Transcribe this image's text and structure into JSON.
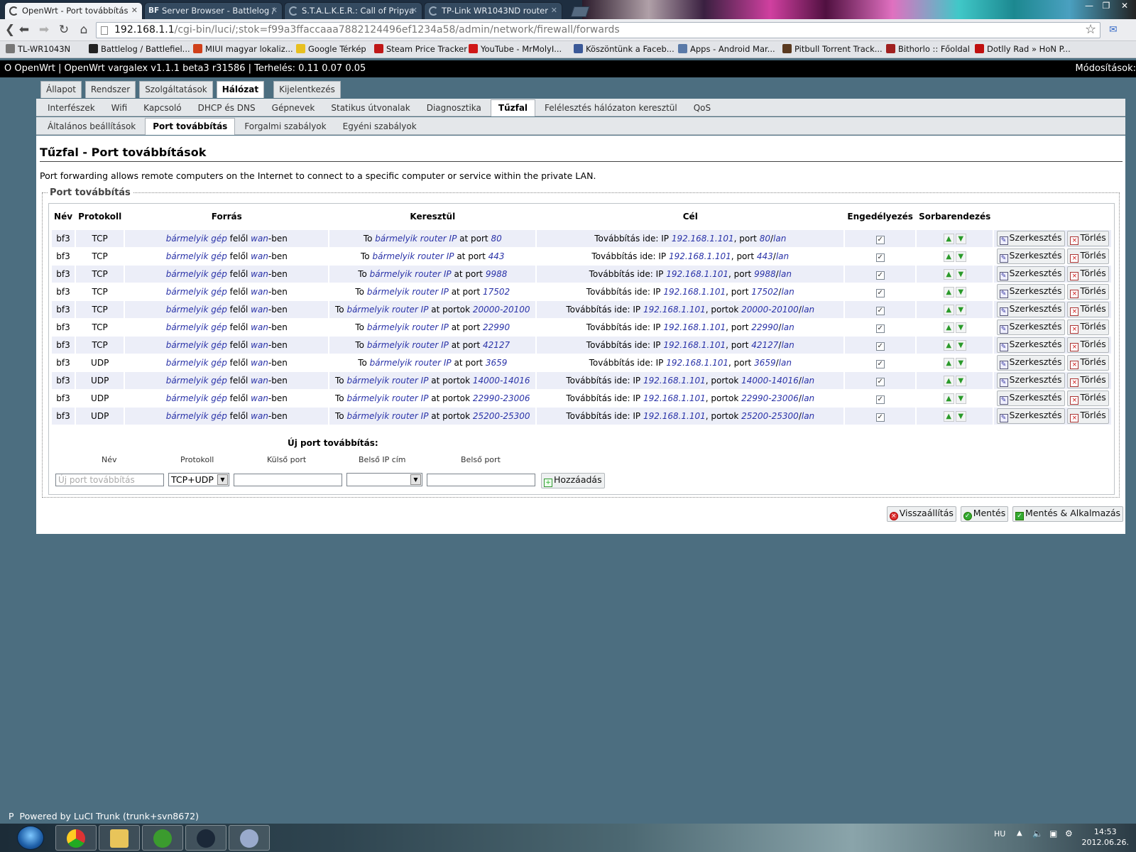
{
  "browser": {
    "tabs": [
      {
        "title": "OpenWrt - Port továbbítás",
        "active": true
      },
      {
        "title": "Server Browser - Battlelog /",
        "active": false
      },
      {
        "title": "S.T.A.L.K.E.R.: Call of Pripya",
        "active": false
      },
      {
        "title": "TP-Link WR1043ND router",
        "active": false
      }
    ],
    "url_host": "192.168.1.1",
    "url_path": "/cgi-bin/luci/;stok=f99a3ffaccaaa7882124496ef1234a58/admin/network/firewall/forwards",
    "bookmarks": [
      {
        "label": "TL-WR1043N",
        "icon": "globe-icon",
        "color": "#777777"
      },
      {
        "label": "Battlelog / Battlefiel...",
        "icon": "battlelog-icon",
        "color": "#222222"
      },
      {
        "label": "MIUI magyar lokaliz...",
        "icon": "miui-icon",
        "color": "#d0401a"
      },
      {
        "label": "Google Térkép",
        "icon": "maps-icon",
        "color": "#e8c020"
      },
      {
        "label": "Steam Price Tracker",
        "icon": "steam-icon",
        "color": "#c01818"
      },
      {
        "label": "YouTube - MrMolyI...",
        "icon": "youtube-icon",
        "color": "#d01818"
      },
      {
        "label": "Köszöntünk a Faceb...",
        "icon": "facebook-icon",
        "color": "#3b5998"
      },
      {
        "label": "Apps - Android Mar...",
        "icon": "play-icon",
        "color": "#5a7aa8"
      },
      {
        "label": "Pitbull Torrent Track...",
        "icon": "pitbull-icon",
        "color": "#5a3a20"
      },
      {
        "label": "Bithorlo :: Főoldal",
        "icon": "bithorlo-icon",
        "color": "#a02020"
      },
      {
        "label": "Dotlly Rad » HoN P...",
        "icon": "hon-icon",
        "color": "#c01010"
      }
    ]
  },
  "header": {
    "status": "OpenWrt | OpenWrt vargalex v1.1.1 beta3 r31586 | Terhelés: 0.11 0.07 0.05",
    "prefix": "O",
    "changes": "Módosítások:"
  },
  "menu_top": [
    "Állapot",
    "Rendszer",
    "Szolgáltatások",
    "Hálózat",
    "Kijelentkezés"
  ],
  "menu_top_selected": "Hálózat",
  "menu_network": [
    "Interfészek",
    "Wifi",
    "Kapcsoló",
    "DHCP és DNS",
    "Gépnevek",
    "Statikus útvonalak",
    "Diagnosztika",
    "Tűzfal",
    "Felélesztés hálózaton keresztül",
    "QoS"
  ],
  "menu_network_selected": "Tűzfal",
  "menu_firewall": [
    "Általános beállítások",
    "Port továbbítás",
    "Forgalmi szabályok",
    "Egyéni szabályok"
  ],
  "menu_firewall_selected": "Port továbbítás",
  "page": {
    "title": "Tűzfal - Port továbbítások",
    "description": "Port forwarding allows remote computers on the Internet to connect to a specific computer or service within the private LAN.",
    "legend": "Port továbbítás"
  },
  "table": {
    "headers": [
      "Név",
      "Protokoll",
      "Forrás",
      "Keresztül",
      "Cél",
      "Engedélyezés",
      "Sorbarendezés"
    ],
    "rows": [
      {
        "name": "bf3",
        "proto": "TCP",
        "via_prefix": "at port",
        "via_port": "80",
        "dest_prefix": "port",
        "dest_port": "80",
        "enabled": true
      },
      {
        "name": "bf3",
        "proto": "TCP",
        "via_prefix": "at port",
        "via_port": "443",
        "dest_prefix": "port",
        "dest_port": "443",
        "enabled": true
      },
      {
        "name": "bf3",
        "proto": "TCP",
        "via_prefix": "at port",
        "via_port": "9988",
        "dest_prefix": "port",
        "dest_port": "9988",
        "enabled": true
      },
      {
        "name": "bf3",
        "proto": "TCP",
        "via_prefix": "at port",
        "via_port": "17502",
        "dest_prefix": "port",
        "dest_port": "17502",
        "enabled": true
      },
      {
        "name": "bf3",
        "proto": "TCP",
        "via_prefix": "at portok",
        "via_port": "20000-20100",
        "dest_prefix": "portok",
        "dest_port": "20000-20100",
        "enabled": true
      },
      {
        "name": "bf3",
        "proto": "TCP",
        "via_prefix": "at port",
        "via_port": "22990",
        "dest_prefix": "port",
        "dest_port": "22990",
        "enabled": true
      },
      {
        "name": "bf3",
        "proto": "TCP",
        "via_prefix": "at port",
        "via_port": "42127",
        "dest_prefix": "port",
        "dest_port": "42127",
        "enabled": true
      },
      {
        "name": "bf3",
        "proto": "UDP",
        "via_prefix": "at port",
        "via_port": "3659",
        "dest_prefix": "port",
        "dest_port": "3659",
        "enabled": true
      },
      {
        "name": "bf3",
        "proto": "UDP",
        "via_prefix": "at portok",
        "via_port": "14000-14016",
        "dest_prefix": "portok",
        "dest_port": "14000-14016",
        "enabled": true
      },
      {
        "name": "bf3",
        "proto": "UDP",
        "via_prefix": "at portok",
        "via_port": "22990-23006",
        "dest_prefix": "portok",
        "dest_port": "22990-23006",
        "enabled": true
      },
      {
        "name": "bf3",
        "proto": "UDP",
        "via_prefix": "at portok",
        "via_port": "25200-25300",
        "dest_prefix": "portok",
        "dest_port": "25200-25300",
        "enabled": true
      }
    ],
    "source_any_host": "bármelyik gép",
    "source_from": "felől",
    "source_zone": "wan",
    "source_zone_suffix": "-ben",
    "via_to": "To",
    "via_any_router": "bármelyik router IP",
    "dest_forward": "Továbbítás ide: IP",
    "dest_ip": "192.168.1.101",
    "dest_zone": "lan",
    "edit_label": "Szerkesztés",
    "delete_label": "Törlés"
  },
  "new_forward": {
    "heading": "Új port továbbítás:",
    "labels": [
      "Név",
      "Protokoll",
      "Külső port",
      "Belső IP cím",
      "Belső port"
    ],
    "name_placeholder": "Új port továbbítás",
    "protocol_value": "TCP+UDP",
    "add_label": "Hozzáadás"
  },
  "actions": {
    "reset": "Visszaállítás",
    "save": "Mentés",
    "save_apply": "Mentés & Alkalmazás"
  },
  "footer": {
    "prefix": "P",
    "text": "Powered by LuCI Trunk (trunk+svn8672)"
  },
  "taskbar": {
    "lang": "HU",
    "time": "14:53",
    "date": "2012.06.26."
  }
}
